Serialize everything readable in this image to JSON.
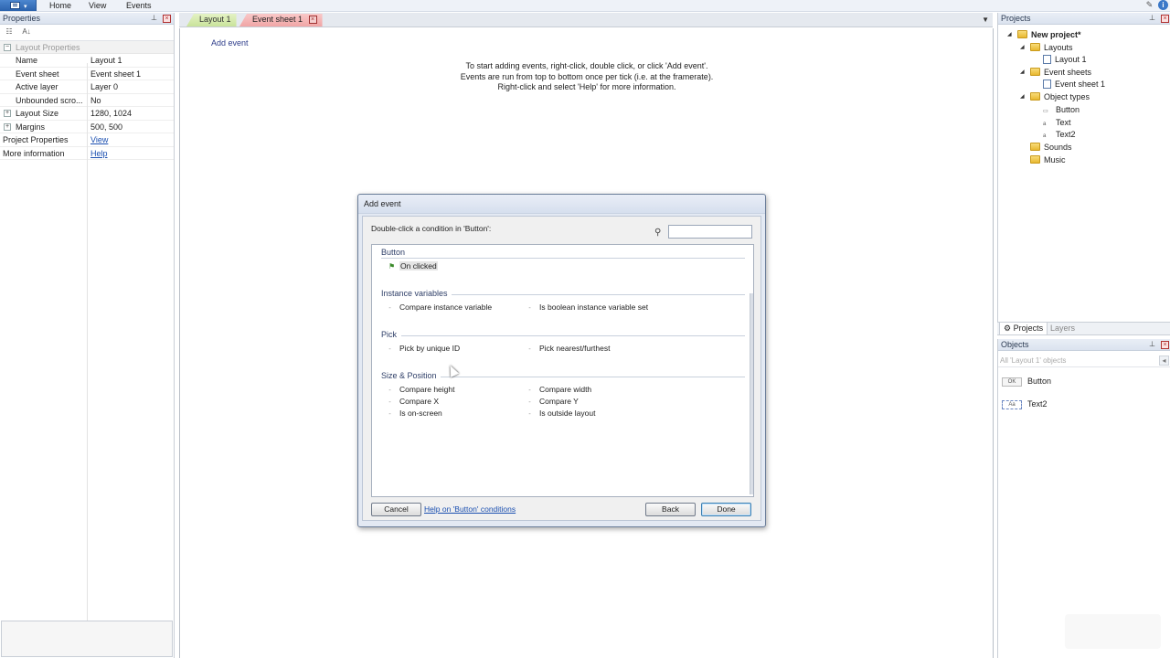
{
  "menubar": {
    "items": [
      "Home",
      "View",
      "Events"
    ]
  },
  "properties": {
    "title": "Properties",
    "section_label": "Layout Properties",
    "rows": [
      {
        "key": "Name",
        "value": "Layout 1"
      },
      {
        "key": "Event sheet",
        "value": "Event sheet 1"
      },
      {
        "key": "Active layer",
        "value": "Layer 0"
      },
      {
        "key": "Unbounded scro...",
        "value": "No"
      },
      {
        "key": "Layout Size",
        "value": "1280, 1024"
      },
      {
        "key": "Margins",
        "value": "500, 500"
      },
      {
        "key": "Project Properties",
        "value": "View"
      },
      {
        "key": "More information",
        "value": "Help"
      }
    ]
  },
  "tabs": [
    {
      "label": "Layout 1",
      "active": false
    },
    {
      "label": "Event sheet 1",
      "active": true
    }
  ],
  "editor": {
    "add_event": "Add event",
    "instructions": [
      "To start adding events, right-click, double click, or click 'Add event'.",
      "Events are run from top to bottom once per tick (i.e. at the framerate).",
      "Right-click and select 'Help' for more information."
    ]
  },
  "projects": {
    "title": "Projects",
    "tree": {
      "root": "New project*",
      "layouts_label": "Layouts",
      "layout_item": "Layout 1",
      "event_sheets_label": "Event sheets",
      "event_sheet_item": "Event sheet 1",
      "object_types_label": "Object types",
      "object_types": [
        "Button",
        "Text",
        "Text2"
      ],
      "sounds_label": "Sounds",
      "music_label": "Music"
    },
    "tabs": [
      "Projects",
      "Layers"
    ]
  },
  "objects": {
    "title": "Objects",
    "filter_placeholder": "All 'Layout 1' objects",
    "items": [
      {
        "thumb": "OK",
        "name": "Button"
      },
      {
        "thumb": "Aa",
        "name": "Text2"
      }
    ]
  },
  "dialog": {
    "title": "Add event",
    "prompt": "Double-click a condition in 'Button':",
    "search_value": "",
    "groups": {
      "button": {
        "label": "Button",
        "items": [
          "On clicked"
        ]
      },
      "instance_variables": {
        "label": "Instance variables",
        "items": [
          "Compare instance variable",
          "Is boolean instance variable set"
        ]
      },
      "pick": {
        "label": "Pick",
        "items": [
          "Pick by unique ID",
          "Pick nearest/furthest"
        ]
      },
      "size_position": {
        "label": "Size & Position",
        "items": [
          "Compare height",
          "Compare width",
          "Compare X",
          "Compare Y",
          "Is on-screen",
          "Is outside layout"
        ]
      }
    },
    "cancel_label": "Cancel",
    "help_label": "Help on 'Button' conditions",
    "back_label": "Back",
    "done_label": "Done"
  },
  "colors": {
    "tab_inactive": "#c9e39a",
    "tab_active": "#f0a5a5",
    "link": "#1a4fb0",
    "dialog_bg": "#e3e9f3"
  }
}
